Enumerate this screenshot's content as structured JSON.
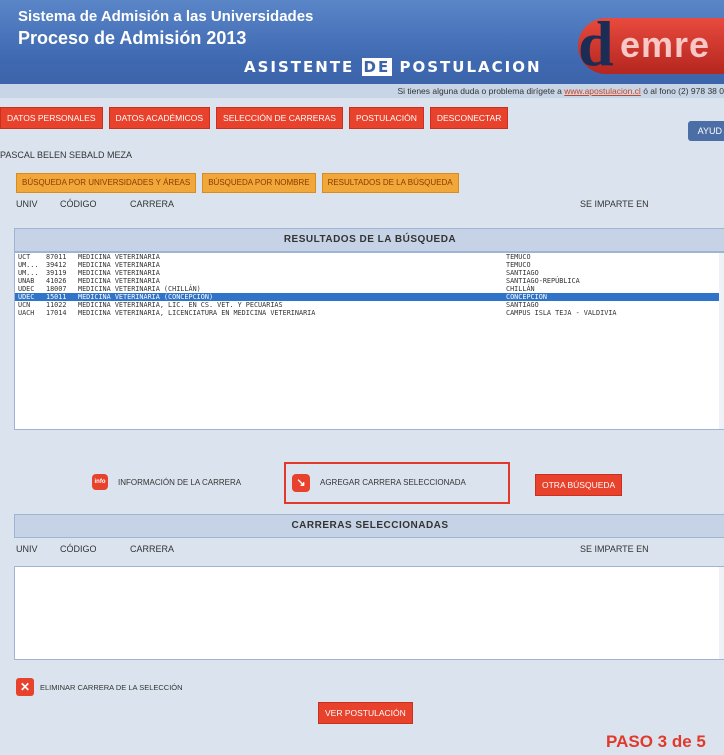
{
  "header": {
    "title_line1": "Sistema de Admisión a las Universidades",
    "title_line2": "Proceso de Admisión 2013",
    "assistant_word1": "ASISTENTE",
    "assistant_word2": "DE",
    "assistant_word3": "POSTULACION",
    "logo_text": "emre",
    "help_prefix": "Si tienes alguna duda o problema dirígete a",
    "help_link": "www.apostulacion.cl",
    "help_suffix": "ó al fono (2) 978 38 0"
  },
  "nav": {
    "items": [
      "DATOS PERSONALES",
      "DATOS ACADÉMICOS",
      "SELECCIÓN DE CARRERAS",
      "POSTULACIÓN",
      "DESCONECTAR"
    ],
    "help": "AYUD"
  },
  "user": {
    "name": "PASCAL BELEN SEBALD MEZA"
  },
  "search_tabs": [
    "BÚSQUEDA POR UNIVERSIDADES Y ÁREAS",
    "BÚSQUEDA POR NOMBRE",
    "RESULTADOS DE LA BÚSQUEDA"
  ],
  "columns": {
    "univ": "UNIV",
    "codigo": "CÓDIGO",
    "carrera": "CARRERA",
    "imparte": "SE IMPARTE EN"
  },
  "results": {
    "title": "RESULTADOS DE LA BÚSQUEDA",
    "rows": [
      {
        "univ": "UCT",
        "code": "87011",
        "name": "MEDICINA VETERINARIA",
        "place": "TEMUCO"
      },
      {
        "univ": "UM...",
        "code": "39412",
        "name": "MEDICINA VETERINARIA",
        "place": "TEMUCO"
      },
      {
        "univ": "UM...",
        "code": "39119",
        "name": "MEDICINA VETERINARIA",
        "place": "SANTIAGO"
      },
      {
        "univ": "UNAB",
        "code": "41026",
        "name": "MEDICINA VETERINARIA",
        "place": "SANTIAGO-REPÚBLICA"
      },
      {
        "univ": "UDEC",
        "code": "18007",
        "name": "MEDICINA VETERINARIA (CHILLÁN)",
        "place": "CHILLÁN"
      },
      {
        "univ": "UDEC",
        "code": "15011",
        "name": "MEDICINA VETERINARIA (CONCEPCION)",
        "place": "CONCEPCION"
      },
      {
        "univ": "UCN",
        "code": "11022",
        "name": "MEDICINA VETERINARIA, LIC. EN CS. VET. Y PECUARIAS",
        "place": "SANTIAGO"
      },
      {
        "univ": "UACH",
        "code": "17014",
        "name": "MEDICINA VETERINARIA, LICENCIATURA EN MEDICINA VETERINARIA",
        "place": "CAMPUS ISLA TEJA - VALDIVIA"
      }
    ],
    "selected_index": 5
  },
  "actions": {
    "info_icon": "info",
    "info_label": "INFORMACIÓN DE LA CARRERA",
    "add_label": "AGREGAR CARRERA SELECCIONADA",
    "other_search": "OTRA BÚSQUEDA"
  },
  "selected": {
    "title": "CARRERAS SELECCIONADAS",
    "rows": []
  },
  "footer": {
    "delete_label": "ELIMINAR CARRERA DE LA SELECCIÓN",
    "view_button": "VER POSTULACIÓN",
    "step": "PASO 3 de 5"
  }
}
